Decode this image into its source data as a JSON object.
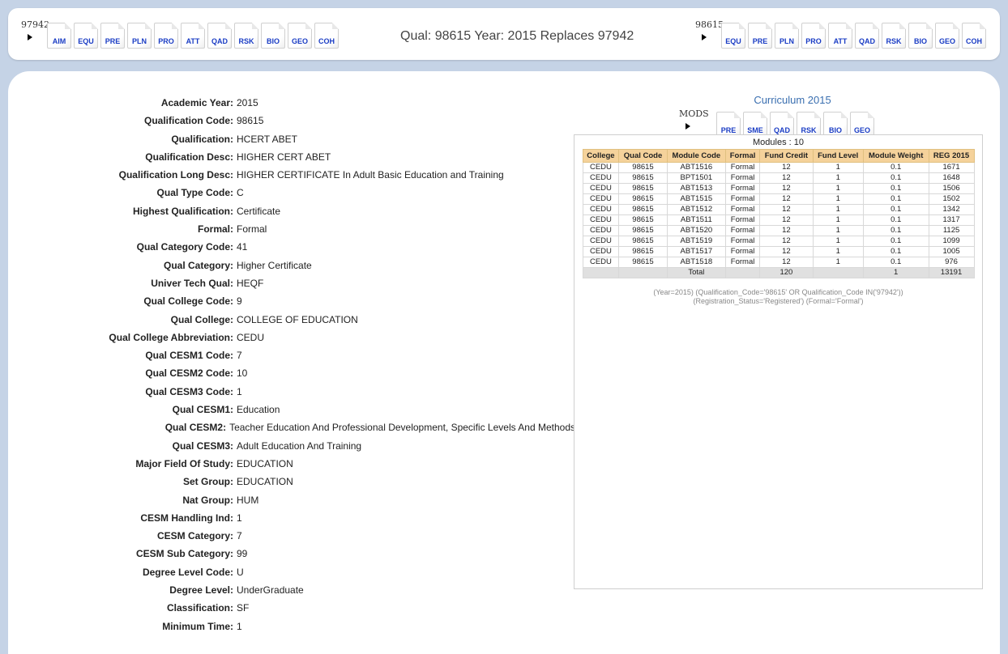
{
  "top": {
    "left_group": {
      "code": "97942",
      "buttons": [
        "AIM",
        "EQU",
        "PRE",
        "PLN",
        "PRO",
        "ATT",
        "QAD",
        "RSK",
        "BIO",
        "GEO",
        "COH"
      ]
    },
    "title": "Qual: 98615   Year: 2015 Replaces 97942",
    "right_group": {
      "code": "98615",
      "buttons": [
        "EQU",
        "PRE",
        "PLN",
        "PRO",
        "ATT",
        "QAD",
        "RSK",
        "BIO",
        "GEO",
        "COH"
      ]
    }
  },
  "fields": [
    {
      "label": "Academic Year:",
      "value": "2015"
    },
    {
      "label": "Qualification Code:",
      "value": "98615"
    },
    {
      "label": "Qualification:",
      "value": "HCERT ABET"
    },
    {
      "label": "Qualification Desc:",
      "value": "HIGHER CERT ABET"
    },
    {
      "label": "Qualification Long Desc:",
      "value": "HIGHER CERTIFICATE In Adult Basic Education and Training"
    },
    {
      "label": "Qual Type Code:",
      "value": "C"
    },
    {
      "label": "Highest Qualification:",
      "value": "Certificate"
    },
    {
      "label": "Formal:",
      "value": "Formal"
    },
    {
      "label": "Qual Category Code:",
      "value": "41"
    },
    {
      "label": "Qual Category:",
      "value": "Higher Certificate"
    },
    {
      "label": "Univer Tech Qual:",
      "value": "HEQF"
    },
    {
      "label": "Qual College Code:",
      "value": "9"
    },
    {
      "label": "Qual College:",
      "value": "COLLEGE OF EDUCATION"
    },
    {
      "label": "Qual College Abbreviation:",
      "value": "CEDU"
    },
    {
      "label": "Qual CESM1 Code:",
      "value": "7"
    },
    {
      "label": "Qual CESM2 Code:",
      "value": "10"
    },
    {
      "label": "Qual CESM3 Code:",
      "value": "1"
    },
    {
      "label": "Qual CESM1:",
      "value": "Education"
    },
    {
      "label": "Qual CESM2:",
      "value": "Teacher Education And Professional Development, Specific Levels And Methods"
    },
    {
      "label": "Qual CESM3:",
      "value": "Adult Education And Training"
    },
    {
      "label": "Major Field Of Study:",
      "value": "EDUCATION"
    },
    {
      "label": "Set Group:",
      "value": "EDUCATION"
    },
    {
      "label": "Nat Group:",
      "value": "HUM"
    },
    {
      "label": "CESM Handling Ind:",
      "value": "1"
    },
    {
      "label": "CESM Category:",
      "value": "7"
    },
    {
      "label": "CESM Sub Category:",
      "value": "99"
    },
    {
      "label": "Degree Level Code:",
      "value": "U"
    },
    {
      "label": "Degree Level:",
      "value": "UnderGraduate"
    },
    {
      "label": "Classification:",
      "value": "SF"
    },
    {
      "label": "Minimum Time:",
      "value": "1"
    }
  ],
  "curriculum": {
    "title": "Curriculum 2015",
    "mods_label": "MODS",
    "mods_buttons": [
      "PRE",
      "SME",
      "QAD",
      "RSK",
      "BIO",
      "GEO"
    ],
    "modules_count": "Modules : 10",
    "headers": [
      "College",
      "Qual Code",
      "Module Code",
      "Formal",
      "Fund Credit",
      "Fund Level",
      "Module Weight",
      "REG 2015"
    ],
    "rows": [
      [
        "CEDU",
        "98615",
        "ABT1516",
        "Formal",
        "12",
        "1",
        "0.1",
        "1671"
      ],
      [
        "CEDU",
        "98615",
        "BPT1501",
        "Formal",
        "12",
        "1",
        "0.1",
        "1648"
      ],
      [
        "CEDU",
        "98615",
        "ABT1513",
        "Formal",
        "12",
        "1",
        "0.1",
        "1506"
      ],
      [
        "CEDU",
        "98615",
        "ABT1515",
        "Formal",
        "12",
        "1",
        "0.1",
        "1502"
      ],
      [
        "CEDU",
        "98615",
        "ABT1512",
        "Formal",
        "12",
        "1",
        "0.1",
        "1342"
      ],
      [
        "CEDU",
        "98615",
        "ABT1511",
        "Formal",
        "12",
        "1",
        "0.1",
        "1317"
      ],
      [
        "CEDU",
        "98615",
        "ABT1520",
        "Formal",
        "12",
        "1",
        "0.1",
        "1125"
      ],
      [
        "CEDU",
        "98615",
        "ABT1519",
        "Formal",
        "12",
        "1",
        "0.1",
        "1099"
      ],
      [
        "CEDU",
        "98615",
        "ABT1517",
        "Formal",
        "12",
        "1",
        "0.1",
        "1005"
      ],
      [
        "CEDU",
        "98615",
        "ABT1518",
        "Formal",
        "12",
        "1",
        "0.1",
        "976"
      ]
    ],
    "total_row": [
      "",
      "",
      "Total",
      "",
      "120",
      "",
      "1",
      "13191"
    ],
    "note_line1": "(Year=2015) (Qualification_Code='98615' OR Qualification_Code IN('97942'))",
    "note_line2": "(Registration_Status='Registered') (Formal='Formal')"
  }
}
